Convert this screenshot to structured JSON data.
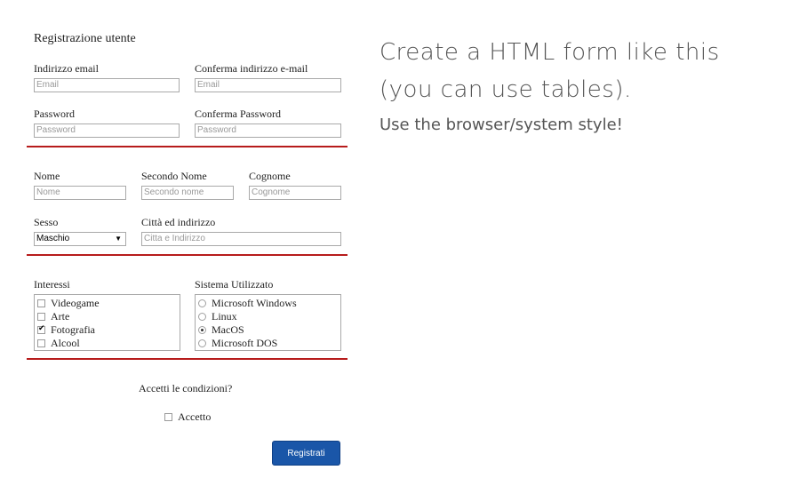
{
  "form": {
    "title": "Registrazione utente",
    "email_label": "Indirizzo email",
    "email_placeholder": "Email",
    "confirm_email_label": "Conferma indirizzo e-mail",
    "confirm_email_placeholder": "Email",
    "password_label": "Password",
    "password_placeholder": "Password",
    "confirm_password_label": "Conferma Password",
    "confirm_password_placeholder": "Password",
    "nome_label": "Nome",
    "nome_placeholder": "Nome",
    "secondo_nome_label": "Secondo Nome",
    "secondo_nome_placeholder": "Secondo nome",
    "cognome_label": "Cognome",
    "cognome_placeholder": "Cognome",
    "sesso_label": "Sesso",
    "sesso_value": "Maschio",
    "citta_label": "Città ed indirizzo",
    "citta_placeholder": "Citta e Indirizzo",
    "interessi_label": "Interessi",
    "interessi": [
      {
        "label": "Videogame",
        "checked": false
      },
      {
        "label": "Arte",
        "checked": false
      },
      {
        "label": "Fotografia",
        "checked": true
      },
      {
        "label": "Alcool",
        "checked": false
      }
    ],
    "sistema_label": "Sistema Utilizzato",
    "sistemi": [
      {
        "label": "Microsoft Windows",
        "checked": false
      },
      {
        "label": "Linux",
        "checked": false
      },
      {
        "label": "MacOS",
        "checked": true
      },
      {
        "label": "Microsoft DOS",
        "checked": false
      }
    ],
    "condizioni_label": "Accetti le condizioni?",
    "accetto_label": "Accetto",
    "submit_label": "Registrati"
  },
  "instructions": {
    "line1": "Create a HTML form like this",
    "line2": "(you can use tables).",
    "line3": "Use the browser/system style!"
  },
  "colors": {
    "divider": "#b71c1c",
    "button": "#1a56a8"
  }
}
